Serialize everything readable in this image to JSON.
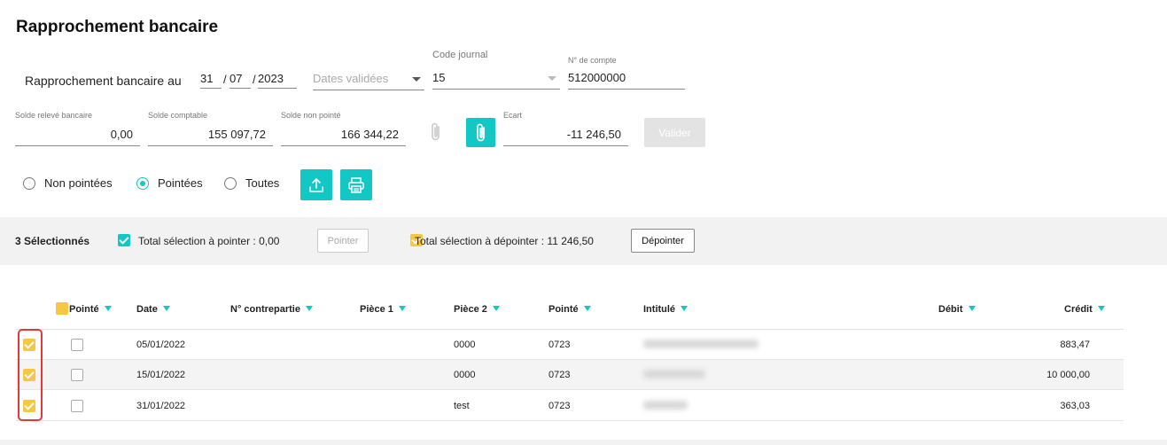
{
  "page": {
    "title": "Rapprochement bancaire"
  },
  "header": {
    "label": "Rapprochement bancaire au",
    "date": {
      "day": "31",
      "month": "07",
      "year": "2023",
      "sep": "/"
    },
    "dates_select": {
      "placeholder": "Dates validées"
    },
    "code_journal": {
      "label": "Code journal",
      "value": "15"
    },
    "compte": {
      "label": "N° de compte",
      "value": "512000000"
    }
  },
  "soldes": {
    "releve": {
      "label": "Solde relevé bancaire",
      "value": "0,00"
    },
    "comptable": {
      "label": "Solde comptable",
      "value": "155 097,72"
    },
    "non_pointe": {
      "label": "Solde non pointé",
      "value": "166 344,22"
    },
    "ecart": {
      "label": "Ecart",
      "value": "-11 246,50"
    },
    "valider_label": "Valider"
  },
  "filters": {
    "options": [
      {
        "label": "Non pointées",
        "selected": false
      },
      {
        "label": "Pointées",
        "selected": true
      },
      {
        "label": "Toutes",
        "selected": false
      }
    ]
  },
  "selection": {
    "count_label": "3 Sélectionnés",
    "total_pointer": "Total sélection à pointer : 0,00",
    "pointer_label": "Pointer",
    "total_depointer": "Total sélection à dépointer : 11 246,50",
    "depointer_label": "Dépointer"
  },
  "table": {
    "headers": [
      "Pointé",
      "Date",
      "N° contrepartie",
      "Pièce 1",
      "Pièce 2",
      "Pointé",
      "Intitulé",
      "Débit",
      "Crédit"
    ],
    "rows": [
      {
        "date": "05/01/2022",
        "piece2": "0000",
        "pointe": "0723",
        "credit": "883,47"
      },
      {
        "date": "15/01/2022",
        "piece2": "0000",
        "pointe": "0723",
        "credit": "10 000,00"
      },
      {
        "date": "31/01/2022",
        "piece2": "test",
        "pointe": "0723",
        "credit": "363,03"
      }
    ]
  },
  "colors": {
    "accent": "#12c7c4",
    "checkbox_selected": "#f7c743",
    "highlight": "#e23a3a"
  },
  "icons": [
    "paperclip-icon",
    "upload-icon",
    "printer-icon",
    "sort-triangle-icon",
    "caret-down-icon"
  ]
}
